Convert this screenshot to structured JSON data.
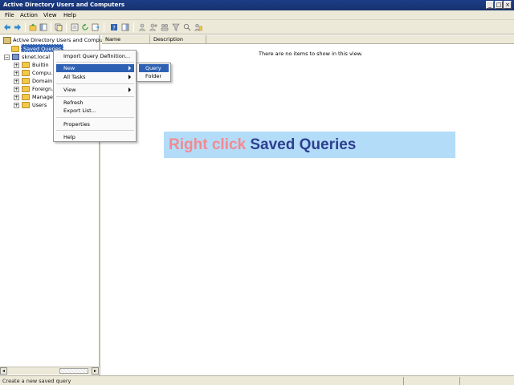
{
  "window": {
    "title": "Active Directory Users and Computers",
    "minimize_glyph": "_",
    "maximize_glyph": "□",
    "close_glyph": "×"
  },
  "menubar": {
    "items": [
      "File",
      "Action",
      "View",
      "Help"
    ]
  },
  "toolbar": {
    "buttons": [
      "back-icon",
      "forward-icon",
      "up-icon",
      "show-hide-console-tree-icon",
      "copy-icon",
      "properties-icon",
      "refresh-icon",
      "export-list-icon",
      "help-icon",
      "action-pane-icon",
      "users-icon",
      "add-user-icon",
      "groups-icon",
      "filter-icon",
      "find-icon",
      "add-to-group-icon"
    ]
  },
  "tree": {
    "root": "Active Directory Users and Compu...",
    "saved_queries": "Saved Queries",
    "domain": "sknet.local",
    "children": [
      "Builtin",
      "Compu...",
      "Domain...",
      "Foreign...",
      "Manage...",
      "Users"
    ],
    "expander_plus": "+",
    "expander_minus": "−"
  },
  "list": {
    "columns": [
      "Name",
      "Description"
    ],
    "empty_message": "There are no items to show in this view."
  },
  "context_menu": {
    "items": [
      {
        "label": "Import Query Definition..."
      },
      {
        "label": "New",
        "submenu": true
      },
      {
        "label": "All Tasks",
        "submenu": true
      },
      {
        "label": "View",
        "submenu": true
      },
      {
        "label": "Refresh"
      },
      {
        "label": "Export List..."
      },
      {
        "label": "Properties"
      },
      {
        "label": "Help"
      }
    ],
    "selected": "New"
  },
  "submenu": {
    "items": [
      "Query",
      "Folder"
    ],
    "selected": "Query"
  },
  "callout": {
    "part1": "Right click ",
    "part2": "Saved Queries",
    "color1": "#f28a8f",
    "color2": "#2f3f8f"
  },
  "statusbar": {
    "text": "Create a new saved query"
  },
  "scroll": {
    "left_glyph": "◂",
    "right_glyph": "▸"
  },
  "colors": {
    "titlebar": "#1c3d86",
    "selection": "#2e61b3",
    "callout_bg": "#b3dcf9"
  }
}
